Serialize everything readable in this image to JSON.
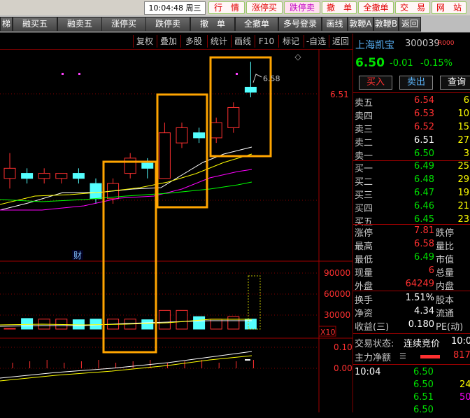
{
  "topbar": {
    "clock": "10:04:48 周三",
    "buttons": [
      {
        "label": "行　情",
        "style": "red"
      },
      {
        "label": "涨停买",
        "style": "red"
      },
      {
        "label": "跌停卖",
        "style": "pink"
      },
      {
        "label": "撤　单",
        "style": "red"
      },
      {
        "label": "全撤单",
        "style": "red"
      },
      {
        "label": "交　易",
        "style": "red"
      },
      {
        "label": "网　站",
        "style": "red"
      }
    ]
  },
  "toolbar2": [
    "梯",
    "融买五",
    "融卖五",
    "涨停买",
    "跌停卖",
    "撤　单",
    "全撤单",
    "多号登录",
    "画线",
    "敦鞭A",
    "敦鞭B",
    "返回"
  ],
  "chart_toolbar": [
    "复权",
    "叠加",
    "多股",
    "统计",
    "画线",
    "F10",
    "标记",
    "-自选",
    "返回"
  ],
  "chart": {
    "price_labels": [
      "6.51"
    ],
    "annotation_high": "6.58",
    "finance_marker": "财",
    "volume_labels": [
      "90000",
      "60000",
      "30000"
    ],
    "volume_unit": "X10",
    "macd_labels": [
      "0.10",
      "0.00"
    ]
  },
  "chart_data": {
    "type": "candlestick",
    "candles": [
      {
        "o": 6.35,
        "c": 6.37,
        "h": 6.4,
        "l": 6.33,
        "v": 1000
      },
      {
        "o": 6.36,
        "c": 6.35,
        "h": 6.37,
        "l": 6.34,
        "v": 17000
      },
      {
        "o": 6.35,
        "c": 6.36,
        "h": 6.37,
        "l": 6.34,
        "v": 16000
      },
      {
        "o": 6.35,
        "c": 6.36,
        "h": 6.36,
        "l": 6.34,
        "v": 16000
      },
      {
        "o": 6.36,
        "c": 6.35,
        "h": 6.37,
        "l": 6.34,
        "v": 15000
      },
      {
        "o": 6.34,
        "c": 6.31,
        "h": 6.35,
        "l": 6.3,
        "v": 16000
      },
      {
        "o": 6.31,
        "c": 6.34,
        "h": 6.35,
        "l": 6.3,
        "v": 16000
      },
      {
        "o": 6.36,
        "c": 6.39,
        "h": 6.4,
        "l": 6.35,
        "v": 16000
      },
      {
        "o": 6.38,
        "c": 6.37,
        "h": 6.39,
        "l": 6.35,
        "v": 15000
      },
      {
        "o": 6.35,
        "c": 6.44,
        "h": 6.46,
        "l": 6.35,
        "v": 30000
      },
      {
        "o": 6.42,
        "c": 6.45,
        "h": 6.46,
        "l": 6.41,
        "v": 30000
      },
      {
        "o": 6.44,
        "c": 6.43,
        "h": 6.45,
        "l": 6.42,
        "v": 20000
      },
      {
        "o": 6.43,
        "c": 6.46,
        "h": 6.47,
        "l": 6.42,
        "v": 16000
      },
      {
        "o": 6.45,
        "c": 6.49,
        "h": 6.5,
        "l": 6.44,
        "v": 20000
      },
      {
        "o": 6.53,
        "c": 6.52,
        "h": 6.58,
        "l": 6.51,
        "v": 16000
      }
    ]
  },
  "panel": {
    "name": "上海凯宝",
    "code": "300039",
    "tag": "R000",
    "price": "6.50",
    "change": "-0.01",
    "change_pct": "-0.15%",
    "buttons": [
      "买入",
      "卖出",
      "查询"
    ],
    "asks": [
      {
        "label": "卖五",
        "price": "6.54",
        "vol": "6"
      },
      {
        "label": "卖四",
        "price": "6.53",
        "vol": "10"
      },
      {
        "label": "卖三",
        "price": "6.52",
        "vol": "15"
      },
      {
        "label": "卖二",
        "price": "6.51",
        "vol": "27"
      },
      {
        "label": "卖一",
        "price": "6.50",
        "vol": "3"
      }
    ],
    "bids": [
      {
        "label": "买一",
        "price": "6.49",
        "vol": "25"
      },
      {
        "label": "买二",
        "price": "6.48",
        "vol": "29"
      },
      {
        "label": "买三",
        "price": "6.47",
        "vol": "19"
      },
      {
        "label": "买四",
        "price": "6.46",
        "vol": "21"
      },
      {
        "label": "买五",
        "price": "6.45",
        "vol": "23"
      }
    ],
    "stats": [
      {
        "label": "涨停",
        "value": "7.81",
        "label2": "跌停"
      },
      {
        "label": "最高",
        "value": "6.58",
        "label2": "量比"
      },
      {
        "label": "最低",
        "value": "6.49",
        "label2": "市值"
      },
      {
        "label": "现量",
        "value": "6",
        "label2": "总量"
      },
      {
        "label": "外盘",
        "value": "64249",
        "label2": "内盘"
      }
    ],
    "stats2": [
      {
        "label": "换手",
        "value": "1.51%",
        "label2": "股本"
      },
      {
        "label": "净资",
        "value": "4.34",
        "label2": "流通"
      },
      {
        "label": "收益(三)",
        "value": "0.180",
        "label2": "PE(动)"
      }
    ],
    "trade_state_label": "交易状态:",
    "trade_state": "连续竞价",
    "trade_time": "10:0",
    "netflow_label": "主力净额",
    "netflow_value": "817",
    "ticks": [
      {
        "time": "10:04",
        "price": "6.50",
        "vol": ""
      },
      {
        "time": "",
        "price": "6.50",
        "vol": "24"
      },
      {
        "time": "",
        "price": "6.51",
        "vol": "50"
      },
      {
        "time": "",
        "price": "6.50",
        "vol": ""
      }
    ]
  },
  "colors": {
    "up": "#ff3030",
    "down": "#54ffff",
    "highlight": "#ffa500",
    "ma5": "#ffffff",
    "ma10": "#ffff00",
    "ma20": "#ff00ff",
    "ma60": "#00ff00"
  }
}
